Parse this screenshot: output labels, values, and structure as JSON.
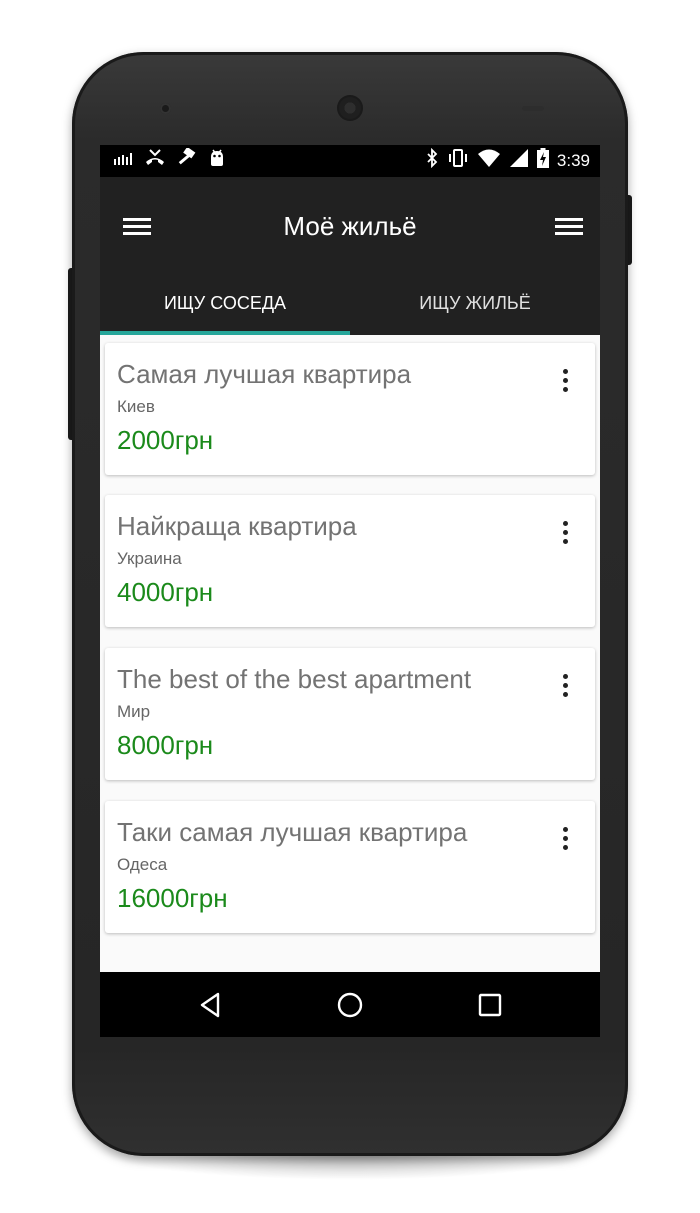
{
  "status_bar": {
    "left_icons": [
      "signal-bars-icon",
      "missed-call-icon",
      "hammer-icon",
      "android-icon"
    ],
    "right_icons": [
      "bluetooth-icon",
      "vibrate-icon",
      "wifi-icon",
      "cell-signal-icon",
      "battery-charging-icon"
    ],
    "time": "3:39"
  },
  "app_bar": {
    "title": "Моё жильё",
    "left_icon": "menu-icon",
    "right_icon": "menu-icon"
  },
  "tabs": [
    {
      "label": "ИЩУ СОСЕДА",
      "selected": true
    },
    {
      "label": "ИЩУ ЖИЛЬЁ",
      "selected": false
    }
  ],
  "listings": [
    {
      "title": "Самая лучшая квартира",
      "city": "Киев",
      "price": "2000грн"
    },
    {
      "title": "Найкраща квартира",
      "city": "Украина",
      "price": "4000грн"
    },
    {
      "title": "The best of the best apartment",
      "city": "Мир",
      "price": "8000грн"
    },
    {
      "title": "Таки самая лучшая квартира",
      "city": "Одеса",
      "price": "16000грн"
    }
  ],
  "nav_bar": [
    "back-icon",
    "home-icon",
    "recents-icon"
  ],
  "colors": {
    "app_bar": "#212121",
    "tab_indicator": "#26a69a",
    "price": "#1b8a1b",
    "title_text": "#737373"
  }
}
